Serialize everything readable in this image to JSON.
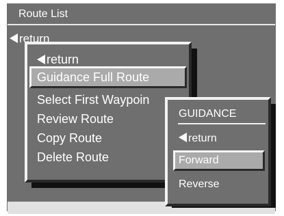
{
  "title": "Route List",
  "top_return": "return",
  "main_menu": {
    "return_label": "return",
    "items": [
      "Guidance Full Route",
      "Select First Waypoin",
      "Review Route",
      "Copy Route",
      "Delete Route"
    ],
    "selected_index": 0
  },
  "guidance_menu": {
    "title": "GUIDANCE",
    "return_label": "return",
    "items": [
      "Forward",
      "Reverse"
    ],
    "selected_index": 0
  },
  "icons": {
    "return": "triangle-left-icon"
  },
  "colors": {
    "panel": "#6f6f6f",
    "highlight": "#aaaaaa",
    "text": "#ffffff"
  }
}
